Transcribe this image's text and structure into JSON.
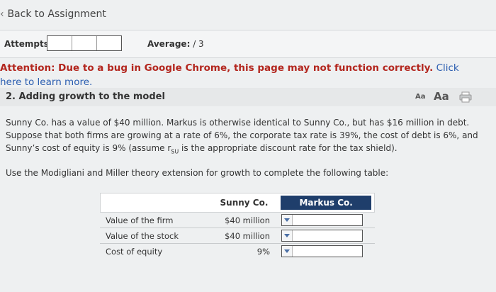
{
  "nav": {
    "back_label": "Back to Assignment"
  },
  "attempts": {
    "label": "Attempts:",
    "average_label": "Average:",
    "average_value": "/ 3"
  },
  "attention": {
    "warning": "Attention: Due to a bug in Google Chrome, this page may not function correctly.",
    "link": "Click here to learn more."
  },
  "question": {
    "title": "2. Adding growth to the model",
    "font_small": "Aa",
    "font_large": "Aa",
    "print_icon": "print-icon"
  },
  "body": {
    "p1_a": "Sunny Co. has a value of $40 million. Markus is otherwise identical to Sunny Co., but has $16 million in debt. Suppose that both firms are growing at a rate of 6%, the corporate tax rate is 39%, the cost of debt is 6%, and Sunny’s cost of equity is 9% (assume r",
    "p1_sub": "SU",
    "p1_b": " is the appropriate discount rate for the tax shield).",
    "instruction": "Use the Modigliani and Miller theory extension for growth to complete the following table:"
  },
  "table": {
    "col_sunny": "Sunny Co.",
    "col_markus": "Markus Co.",
    "rows": [
      {
        "label": "Value of the firm",
        "sunny": "$40 million",
        "markus": ""
      },
      {
        "label": "Value of the stock",
        "sunny": "$40 million",
        "markus": ""
      },
      {
        "label": "Cost of equity",
        "sunny": "9%",
        "markus": ""
      }
    ]
  }
}
